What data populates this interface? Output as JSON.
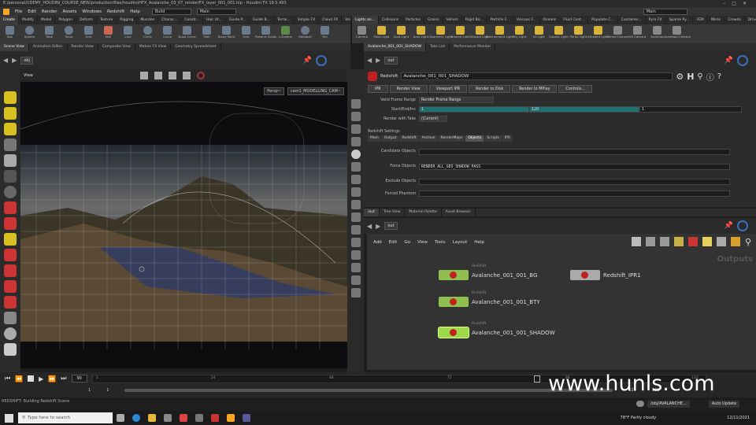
{
  "window_title": "E:/personal/UDEMY_HOUDINI_COURSE_NEW/production/files/houdini/HFX_Avalanche_03_07_render/FX_layer_001_001.hip - Houdini FX 19.5.493",
  "window_controls": [
    "–",
    "□",
    "✕"
  ],
  "menu": [
    "File",
    "Edit",
    "Render",
    "Assets",
    "Windows",
    "Redshift",
    "Help"
  ],
  "desktop_build": "Build",
  "desktop_main": "Main",
  "right_desktop": "Main",
  "shelf_tabs_left": [
    "Create",
    "Modify",
    "Model",
    "Polygon",
    "Deform",
    "Texture",
    "Rigging",
    "Muscles",
    "Charac...",
    "Constr...",
    "Hair Ut...",
    "Guide P...",
    "Guide B...",
    "Terrai...",
    "Simple FX",
    "Cloud FX",
    "Volume"
  ],
  "shelf_tabs_right": [
    "Lights an...",
    "Collisions",
    "Particles",
    "Grains",
    "Vellum",
    "Rigid Bo...",
    "Particle F...",
    "Viscous F...",
    "Oceans",
    "Fluid Cont...",
    "Populate C...",
    "Container...",
    "Pyro FX",
    "Sparse Py...",
    "FEM",
    "Wires",
    "Crowds",
    "Drive Sim"
  ],
  "shelf_tools_left": [
    "Box",
    "Sphere",
    "Tube",
    "Torus",
    "Grid",
    "Null",
    "Line",
    "Circle",
    "Curve",
    "Draw Curve",
    "Path",
    "Spray Paint",
    "Font",
    "Platonic Solids",
    "L-System",
    "Metaball",
    "File"
  ],
  "shelf_tools_right": [
    "Camera",
    "Point Light",
    "Spot Light",
    "Area Light",
    "Geometry Light",
    "Volume Light",
    "Distant Light",
    "Environment Light",
    "Sky Light",
    "GI Light",
    "Caustic Light",
    "Portal Light",
    "Ambient Light",
    "Stereo Camera",
    "VR Camera",
    "Switcher",
    "Gamepad Camera"
  ],
  "left_pane_tabs": [
    "Scene View",
    "Animation Editor",
    "Render View",
    "Composite View",
    "Motion FX View",
    "Geometry Spreadsheet"
  ],
  "left_path": "obj",
  "viewport": {
    "label": "View",
    "persp": "Persp~",
    "camera": "cam1_MODELLING_CAM~"
  },
  "right_top_tabs": [
    "Avalanche_001_001_SHADOW",
    "Take List",
    "Performance Monitor"
  ],
  "right_path": "out",
  "node_header": {
    "type": "Redshift",
    "name": "Avalanche_001_001_SHADOW"
  },
  "render_buttons": [
    "IPR",
    "Render View",
    "Viewport IPR",
    "Render to Disk",
    "Render to MPlay",
    "Controls..."
  ],
  "params": {
    "valid_frame_range_label": "Valid Frame Range",
    "valid_frame_range_value": "Render Frame Range",
    "start_end_label": "Start/End/Inc",
    "start": "1",
    "end": "120",
    "inc": "1",
    "render_with_take_label": "Render with Take",
    "render_with_take_value": "(Current)"
  },
  "redshift_settings_label": "Redshift Settings",
  "settings_tabs": [
    "Main",
    "Output",
    "Redshift",
    "Archive",
    "RenderMaps",
    "Objects",
    "Scripts",
    "IPR"
  ],
  "objects_params": [
    {
      "label": "Candidate Objects",
      "value": ""
    },
    {
      "label": "Force Objects",
      "value": "RENDER_ALL_GEO_SHADOW_PASS"
    },
    {
      "label": "Exclude Objects",
      "value": ""
    },
    {
      "label": "Forced Phantom",
      "value": ""
    }
  ],
  "network_tabs": [
    "/out",
    "Tree View",
    "Material Palette",
    "Asset Browser"
  ],
  "network_path": "out",
  "network_menu": [
    "Add",
    "Edit",
    "Go",
    "View",
    "Tools",
    "Layout",
    "Help"
  ],
  "network_context_label": "Outputs",
  "nodes": [
    {
      "type": "Redshift",
      "name": "Avalanche_001_001_BG",
      "color": "#8fbf4f"
    },
    {
      "type": "Redshift",
      "name": "Avalanche_001_001_BTY",
      "color": "#8fbf4f"
    },
    {
      "type": "Redshift",
      "name": "Avalanche_001_001_SHADOW",
      "color": "#8fbf4f"
    },
    {
      "type": "",
      "name": "Redshift_IPR1",
      "color": "#aaaaaa"
    }
  ],
  "timeline": {
    "current_frame": "90",
    "ticks": [
      "1",
      "24",
      "48",
      "72",
      "96",
      "120"
    ],
    "start": "1",
    "end": "120",
    "range_start": "1",
    "range_end": "120"
  },
  "status_text": "REDSHIFT: Building Redshift Scene",
  "watermark": "www.hunls.com",
  "taskbar": {
    "search_placeholder": "Type here to search",
    "weather": "78°F  Partly cloudy",
    "auto_update": "Auto Update",
    "obj_path": "/obj/AVALANCHE...",
    "date": "12/11/2021"
  },
  "accent_color": "#f5a623",
  "node_selected_color": "#9cd84a"
}
